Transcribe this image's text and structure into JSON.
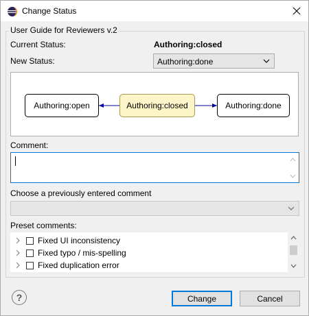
{
  "window": {
    "title": "Change Status"
  },
  "group": {
    "title": "User Guide for Reviewers v.2"
  },
  "current_status": {
    "label": "Current Status:",
    "value": "Authoring:closed"
  },
  "new_status": {
    "label": "New Status:",
    "selected": "Authoring:done"
  },
  "diagram": {
    "nodes": [
      {
        "label": "Authoring:open"
      },
      {
        "label": "Authoring:closed"
      },
      {
        "label": "Authoring:done"
      }
    ],
    "current_index": 1,
    "current_fill": "#fcf5c8",
    "arrow_color": "#000099"
  },
  "comment": {
    "label": "Comment:",
    "value": ""
  },
  "previous_comment": {
    "label": "Choose a previously entered comment",
    "selected": ""
  },
  "preset": {
    "label": "Preset comments:",
    "items": [
      {
        "label": "Fixed UI inconsistency",
        "checked": false
      },
      {
        "label": "Fixed typo / mis-spelling",
        "checked": false
      },
      {
        "label": "Fixed duplication error",
        "checked": false
      }
    ]
  },
  "buttons": {
    "help": "?",
    "change": "Change",
    "cancel": "Cancel"
  },
  "colors": {
    "accent": "#0078d7",
    "icon": "#2c2255"
  }
}
